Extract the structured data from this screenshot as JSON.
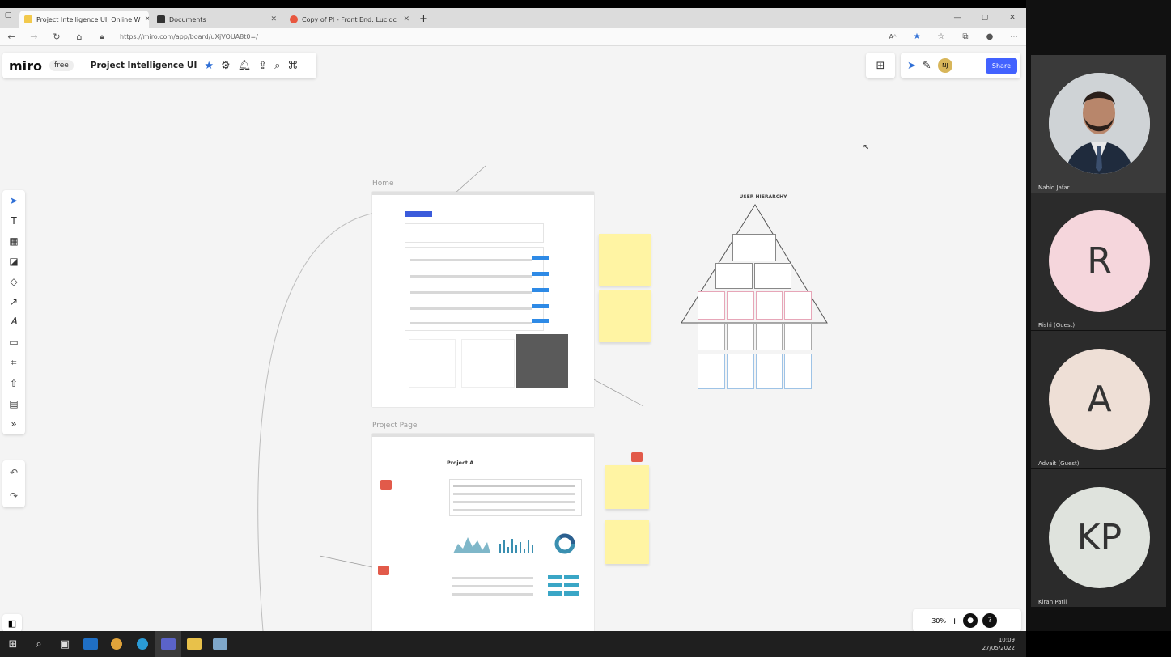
{
  "browser": {
    "tabs": [
      {
        "title": "Project Intelligence UI, Online W",
        "favicon_color": "#f2c94c"
      },
      {
        "title": "Documents",
        "favicon_color": "#333333"
      },
      {
        "title": "Copy of PI - Front End: Lucidc",
        "favicon_color": "#e8573f"
      }
    ],
    "new_tab": "+",
    "url": "https://miro.com/app/board/uXjVOUA8t0=/"
  },
  "miro": {
    "logo": "miro",
    "plan": "free",
    "board_title": "Project Intelligence UI",
    "share_label": "Share",
    "avatar_initials": "NJ",
    "zoom_level": "30%",
    "zoom_minus": "−",
    "zoom_plus": "+",
    "help": "?"
  },
  "board": {
    "frame_home": "Home",
    "frame_project_page": "Project Page",
    "project_heading": "Project A",
    "hierarchy_title": "USER HIERARCHY"
  },
  "meeting": {
    "participants": [
      {
        "name": "Nahid Jafar",
        "initials": ""
      },
      {
        "name": "Rishi (Guest)",
        "initials": "R",
        "color": "#f5d6dc"
      },
      {
        "name": "Advait (Guest)",
        "initials": "A",
        "color": "#eedfd6"
      },
      {
        "name": "Kiran Patil",
        "initials": "KP",
        "color": "#dfe3dd"
      }
    ]
  },
  "taskbar": {
    "time": "10:09",
    "date": "27/05/2022"
  }
}
